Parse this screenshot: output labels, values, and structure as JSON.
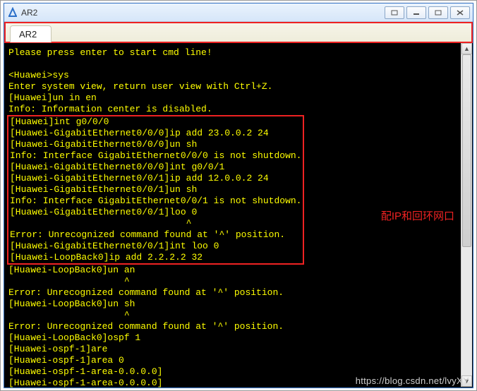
{
  "window": {
    "title": "AR2"
  },
  "tabs": {
    "active": "AR2"
  },
  "annotation": "配IP和回环网口",
  "watermark": "https://blog.csdn.net/lvyXY",
  "term": {
    "l0": "Please press enter to start cmd line!",
    "l1": "",
    "l2": "<Huawei>sys",
    "l3": "Enter system view, return user view with Ctrl+Z.",
    "l4": "[Huawei]un in en",
    "l5": "Info: Information center is disabled.",
    "l6": "[Huawei]int g0/0/0",
    "l7": "[Huawei-GigabitEthernet0/0/0]ip add 23.0.0.2 24",
    "l8": "[Huawei-GigabitEthernet0/0/0]un sh",
    "l9": "Info: Interface GigabitEthernet0/0/0 is not shutdown.",
    "l10": "[Huawei-GigabitEthernet0/0/0]int g0/0/1",
    "l11": "[Huawei-GigabitEthernet0/0/1]ip add 12.0.0.2 24",
    "l12": "[Huawei-GigabitEthernet0/0/1]un sh",
    "l13": "Info: Interface GigabitEthernet0/0/1 is not shutdown.",
    "l14": "[Huawei-GigabitEthernet0/0/1]loo 0",
    "l14c": "                                ^",
    "l15": "Error: Unrecognized command found at '^' position.",
    "l16": "[Huawei-GigabitEthernet0/0/1]int loo 0",
    "l17": "[Huawei-LoopBack0]ip add 2.2.2.2 32",
    "l18": "[Huawei-LoopBack0]un an",
    "l18c": "                     ^",
    "l19": "Error: Unrecognized command found at '^' position.",
    "l20": "[Huawei-LoopBack0]un sh",
    "l20c": "                     ^",
    "l21": "Error: Unrecognized command found at '^' position.",
    "l22": "[Huawei-LoopBack0]ospf 1",
    "l23": "[Huawei-ospf-1]are",
    "l24": "[Huawei-ospf-1]area 0",
    "l25": "[Huawei-ospf-1-area-0.0.0.0]",
    "l26": "[Huawei-ospf-1-area-0.0.0.0]"
  }
}
